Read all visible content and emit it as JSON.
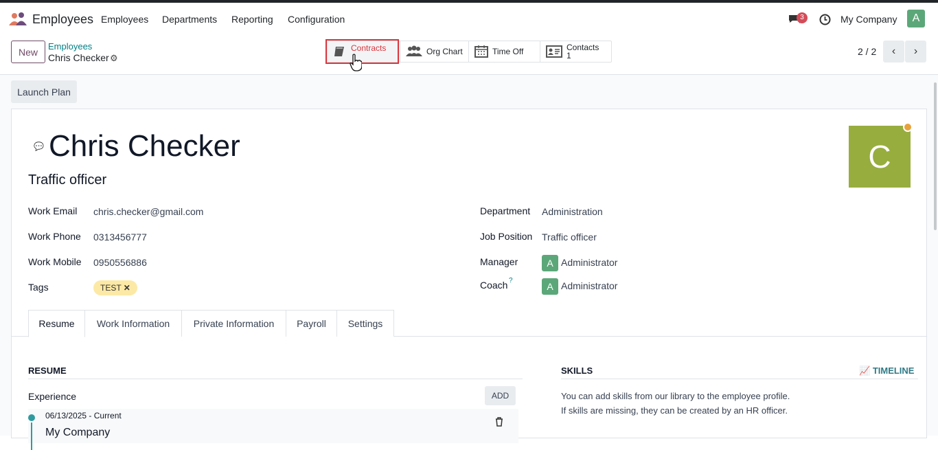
{
  "navbar": {
    "app_name": "Employees",
    "menu": [
      "Employees",
      "Departments",
      "Reporting",
      "Configuration"
    ],
    "message_count": "3",
    "company": "My Company",
    "user_initial": "A"
  },
  "control": {
    "new_label": "New",
    "breadcrumb_parent": "Employees",
    "breadcrumb_current": "Chris Checker",
    "smart_buttons": {
      "contracts": "Contracts",
      "org_chart": "Org Chart",
      "time_off": "Time Off",
      "contacts": "Contacts",
      "contacts_count": "1"
    },
    "pager": "2 / 2"
  },
  "form": {
    "launch_plan": "Launch Plan",
    "name": "Chris Checker",
    "job_title": "Traffic officer",
    "avatar_initial": "C",
    "labels": {
      "work_email": "Work Email",
      "work_phone": "Work Phone",
      "work_mobile": "Work Mobile",
      "tags": "Tags",
      "department": "Department",
      "job_position": "Job Position",
      "manager": "Manager",
      "coach": "Coach",
      "coach_help": "?"
    },
    "values": {
      "work_email": "chris.checker@gmail.com",
      "work_phone": "0313456777",
      "work_mobile": "0950556886",
      "tag": "TEST",
      "department": "Administration",
      "job_position": "Traffic officer",
      "manager": "Administrator",
      "manager_initial": "A",
      "coach": "Administrator",
      "coach_initial": "A"
    },
    "tabs": [
      "Resume",
      "Work Information",
      "Private Information",
      "Payroll",
      "Settings"
    ],
    "resume": {
      "title": "RESUME",
      "experience": "Experience",
      "add": "ADD",
      "entry_date": "06/13/2025 - Current",
      "entry_company": "My Company"
    },
    "skills": {
      "title": "SKILLS",
      "timeline": "TIMELINE",
      "line1": "You can add skills from our library to the employee profile.",
      "line2": "If skills are missing, they can be created by an HR officer."
    }
  },
  "colors": {
    "brand": "#714b67",
    "teal": "#017e84",
    "highlight": "#d9353b",
    "avatar_bg": "#97ad3e"
  }
}
